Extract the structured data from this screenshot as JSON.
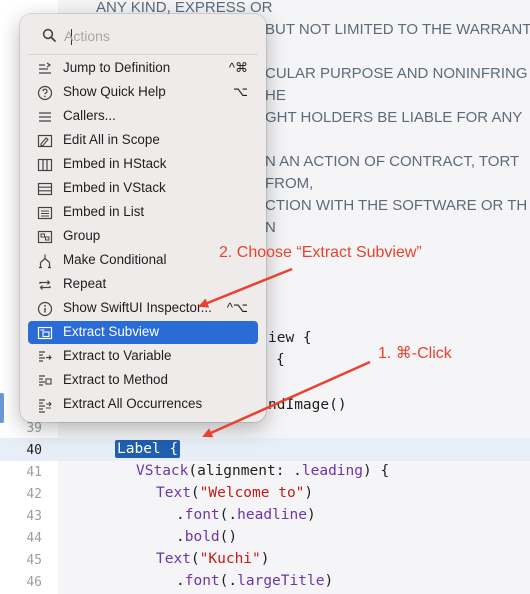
{
  "license_text": [
    "ANY KIND, EXPRESS OR",
    "BUT NOT LIMITED TO THE WARRANT",
    "CULAR PURPOSE AND NONINFRING",
    "HE",
    "GHT HOLDERS BE LIABLE FOR ANY",
    "N AN ACTION OF CONTRACT, TORT",
    "FROM,",
    "CTION WITH THE SOFTWARE OR TH",
    "N"
  ],
  "behind_menu_code": [
    "iew {",
    "{",
    "ndImage()"
  ],
  "menu": {
    "search_placeholder": "Actions",
    "items": [
      {
        "label": "Jump to Definition",
        "shortcut": "^⌘",
        "icon": "jump-to-definition-icon"
      },
      {
        "label": "Show Quick Help",
        "shortcut": "⌥",
        "icon": "quick-help-icon"
      },
      {
        "label": "Callers...",
        "shortcut": "",
        "icon": "callers-icon"
      },
      {
        "label": "Edit All in Scope",
        "shortcut": "",
        "icon": "edit-all-in-scope-icon"
      },
      {
        "label": "Embed in HStack",
        "shortcut": "",
        "icon": "embed-hstack-icon"
      },
      {
        "label": "Embed in VStack",
        "shortcut": "",
        "icon": "embed-vstack-icon"
      },
      {
        "label": "Embed in List",
        "shortcut": "",
        "icon": "embed-list-icon"
      },
      {
        "label": "Group",
        "shortcut": "",
        "icon": "group-icon"
      },
      {
        "label": "Make Conditional",
        "shortcut": "",
        "icon": "make-conditional-icon"
      },
      {
        "label": "Repeat",
        "shortcut": "",
        "icon": "repeat-icon"
      },
      {
        "label": "Show SwiftUI Inspector...",
        "shortcut": "^⌥",
        "icon": "swiftui-inspector-icon"
      },
      {
        "label": "Extract Subview",
        "shortcut": "",
        "icon": "extract-subview-icon",
        "selected": true
      },
      {
        "label": "Extract to Variable",
        "shortcut": "",
        "icon": "extract-variable-icon"
      },
      {
        "label": "Extract to Method",
        "shortcut": "",
        "icon": "extract-method-icon"
      },
      {
        "label": "Extract All Occurrences",
        "shortcut": "",
        "icon": "extract-all-occurrences-icon"
      }
    ]
  },
  "editor": {
    "lines": [
      {
        "num": "39",
        "code": ""
      },
      {
        "num": "40",
        "code": "Label {"
      },
      {
        "num": "41",
        "code": "VStack(alignment: .leading) {"
      },
      {
        "num": "42",
        "code": "Text(\"Welcome to\")"
      },
      {
        "num": "43",
        "code": ".font(.headline)"
      },
      {
        "num": "44",
        "code": ".bold()"
      },
      {
        "num": "45",
        "code": "Text(\"Kuchi\")"
      },
      {
        "num": "46",
        "code": ".font(.largeTitle)"
      }
    ]
  },
  "annotations": {
    "step1": "1. ⌘-Click",
    "step2": "2. Choose “Extract Subview”",
    "color": "#e8432f"
  },
  "colors": {
    "selection": "#2a6cd6",
    "code_selection": "#1f5fb0",
    "type_keyword": "#6d35a8",
    "string_literal": "#c41a16"
  }
}
